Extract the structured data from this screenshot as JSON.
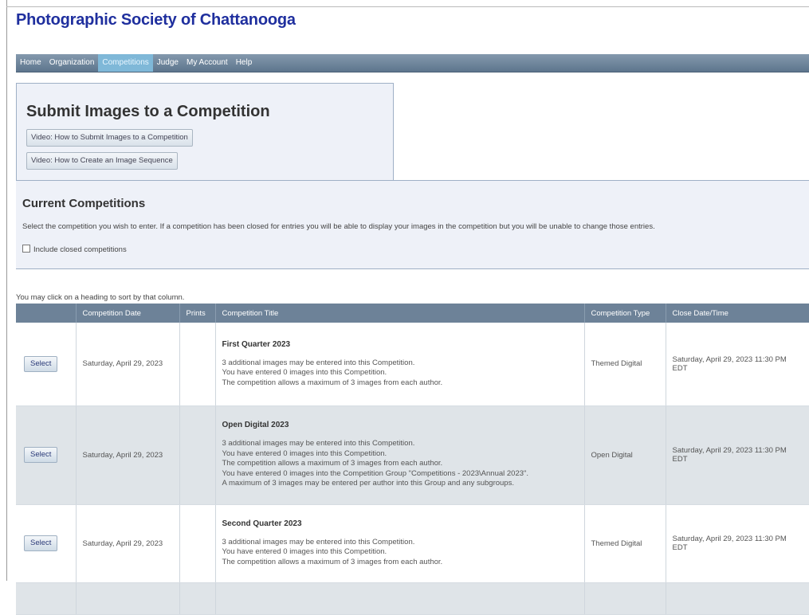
{
  "header": {
    "site_title": "Photographic Society of Chattanooga"
  },
  "nav": {
    "items": [
      {
        "label": "Home"
      },
      {
        "label": "Organization"
      },
      {
        "label": "Competitions"
      },
      {
        "label": "Judge"
      },
      {
        "label": "My Account"
      },
      {
        "label": "Help"
      }
    ],
    "active": "Competitions"
  },
  "submit_panel": {
    "title": "Submit Images to a Competition",
    "video1_label": "Video: How to Submit Images to a Competition",
    "video2_label": "Video: How to Create an Image Sequence"
  },
  "current_panel": {
    "title": "Current Competitions",
    "description": "Select the competition you wish to enter. If a competition has been closed for entries you will be able to display your images in the competition but you will be unable to change those entries.",
    "checkbox_label": "Include closed competitions",
    "checkbox_checked": false
  },
  "sort_hint": "You may click on a heading to sort by that column.",
  "table": {
    "headers": {
      "blank": "",
      "date": "Competition Date",
      "prints": "Prints",
      "title": "Competition Title",
      "type": "Competition Type",
      "close": "Close Date/Time"
    },
    "select_label": "Select",
    "rows": [
      {
        "date": "Saturday, April 29, 2023",
        "prints": "",
        "title": "First Quarter 2023",
        "lines": [
          "3 additional images may be entered into this Competition.",
          "You have entered 0 images into this Competition.",
          "The competition allows a maximum of 3 images from each author."
        ],
        "type": "Themed Digital",
        "close": "Saturday, April 29, 2023 11:30 PM EDT"
      },
      {
        "date": "Saturday, April 29, 2023",
        "prints": "",
        "title": "Open Digital 2023",
        "lines": [
          "3 additional images may be entered into this Competition.",
          "You have entered 0 images into this Competition.",
          "The competition allows a maximum of 3 images from each author.",
          "You have entered 0 images into the Competition Group \"Competitions - 2023\\Annual 2023\".",
          "A maximum of 3 images may be entered per author into this Group and any subgroups."
        ],
        "type": "Open Digital",
        "close": "Saturday, April 29, 2023 11:30 PM EDT"
      },
      {
        "date": "Saturday, April 29, 2023",
        "prints": "",
        "title": "Second Quarter 2023",
        "lines": [
          "3 additional images may be entered into this Competition.",
          "You have entered 0 images into this Competition.",
          "The competition allows a maximum of 3 images from each author."
        ],
        "type": "Themed Digital",
        "close": "Saturday, April 29, 2023 11:30 PM EDT"
      }
    ]
  }
}
